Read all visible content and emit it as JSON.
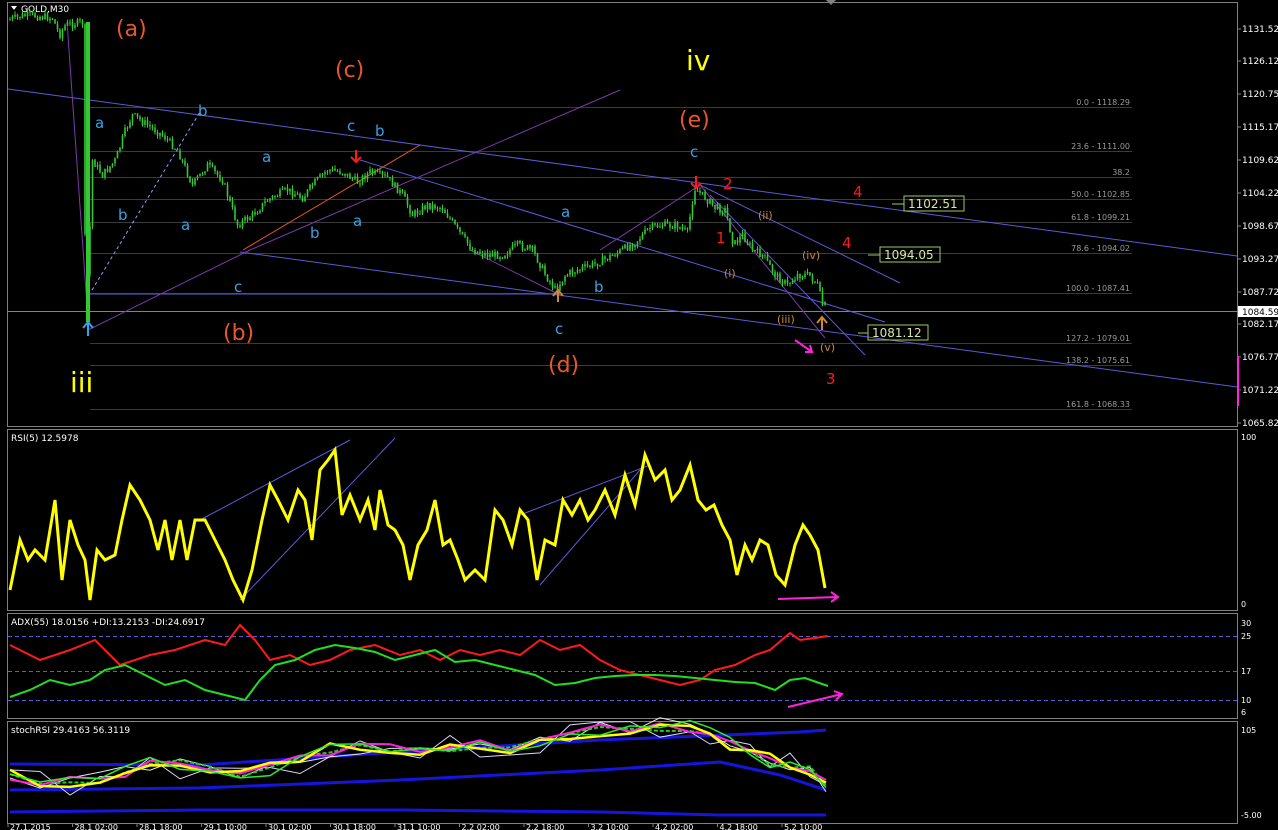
{
  "colors": {
    "background": "#000000",
    "grid_border": "#808080",
    "candle": "#34c934",
    "trend": "#5a5ad8",
    "fib": "#3a3a3a",
    "yellow": "#ffff00",
    "orange": "#e8572a",
    "cyan": "#36a3e6",
    "red": "#ff1a1a",
    "brown": "#cc8833",
    "magenta": "#ff22dd",
    "green": "#22dd22",
    "price_box_border": "#a0c860",
    "price_box_text": "#d8e8a0"
  },
  "main": {
    "title": "GOLD,M30",
    "price_axis": [
      "1131.52",
      "1126.12",
      "1120.75",
      "1115.17",
      "1109.62",
      "1104.22",
      "1098.67",
      "1093.27",
      "1087.72",
      "1082.17",
      "1076.77",
      "1071.22",
      "1065.82"
    ],
    "current_price": "1084.59",
    "fib_labels": [
      {
        "text": "0.0 - 1118.29"
      },
      {
        "text": "23.6 - 1111.00"
      },
      {
        "text": "38.2"
      },
      {
        "text": "50.0 - 1102.85"
      },
      {
        "text": "61.8 - 1099.21"
      },
      {
        "text": "78.6 - 1094.02"
      },
      {
        "text": "100.0 - 1087.41"
      },
      {
        "text": "127.2 - 1079.01"
      },
      {
        "text": "138.2 - 1075.61"
      },
      {
        "text": "161.8 - 1068.33"
      }
    ],
    "price_boxes": [
      "1102.51",
      "1094.05",
      "1081.12"
    ],
    "wave_labels": {
      "a_big": "(a)",
      "b_big": "(b)",
      "c_big": "(c)",
      "d_big": "(d)",
      "e_big": "(e)",
      "iii": "iii",
      "iv": "iv",
      "small_a": "a",
      "small_b": "b",
      "small_c": "c",
      "n1": "1",
      "n2": "2",
      "n3": "3",
      "n4": "4",
      "r_i": "(i)",
      "r_ii": "(ii)",
      "r_iii": "(iii)",
      "r_iv": "(iv)",
      "r_v": "(v)"
    }
  },
  "rsi": {
    "title": "RSI(5) 12.5978",
    "axis_top": "100",
    "axis_bottom": "0"
  },
  "adx": {
    "title": "ADX(55) 18.0156 +DI:13.2153 -DI:24.6917",
    "levels": [
      "30",
      "25",
      "17",
      "10",
      "6"
    ]
  },
  "stoch": {
    "title": "stochRSI 29.4163 56.3119",
    "axis_top": "105",
    "axis_bottom": "-5.00"
  },
  "time_axis": [
    "27.1.2015",
    "28.1 02:00",
    "28.1 18:00",
    "29.1 10:00",
    "30.1 02:00",
    "30.1 18:00",
    "31.1 10:00",
    "2.2 02:00",
    "2.2 18:00",
    "3.2 10:00",
    "4.2 02:00",
    "4.2 18:00",
    "5.2 10:00"
  ]
}
